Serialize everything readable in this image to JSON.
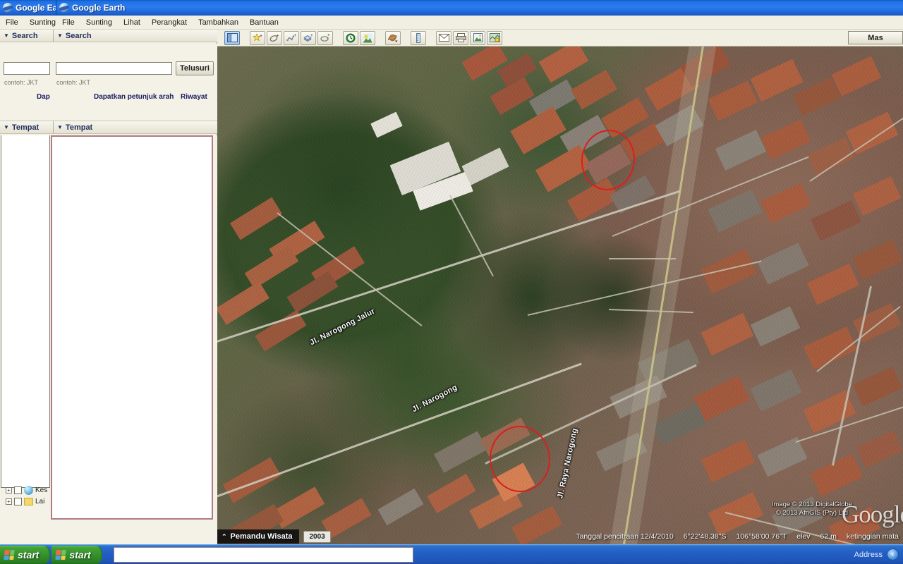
{
  "window": {
    "back_title": "Google Ea",
    "front_title": "Google Earth",
    "app_icon": "google-earth-globe-icon"
  },
  "menubar_back": [
    "File",
    "Sunting"
  ],
  "menubar_front": [
    "File",
    "Sunting",
    "Lihat",
    "Perangkat",
    "Tambahkan",
    "Bantuan"
  ],
  "sidebar": {
    "search_panel": {
      "title_back": "Search",
      "title_front": "Search",
      "input_small_value": "",
      "input_small_placeholder": "",
      "input_large_value": "",
      "input_large_placeholder": "",
      "search_button": "Telusuri",
      "hint_left": "contoh: JKT",
      "hint_right": "contoh: JKT",
      "link_directions_short": "Dap",
      "link_directions": "Dapatkan petunjuk arah",
      "link_history": "Riwayat"
    },
    "places_panel": {
      "title_back": "Tempat",
      "title_front": "Tempat"
    },
    "layers": [
      {
        "label": "Kes",
        "icon": "globe-icon",
        "checked": false
      },
      {
        "label": "Lai",
        "icon": "folder-icon",
        "checked": false
      }
    ]
  },
  "toolbar": {
    "buttons": [
      {
        "name": "toggle-sidebar",
        "glyph": "▥",
        "active": true
      },
      {
        "name": "add-placemark",
        "glyph": "★",
        "active": false
      },
      {
        "name": "add-polygon",
        "glyph": "⬭",
        "active": false
      },
      {
        "name": "add-path",
        "glyph": "⌁",
        "active": false
      },
      {
        "name": "add-image-overlay",
        "glyph": "▤",
        "active": false
      },
      {
        "name": "record-tour",
        "glyph": "⟳",
        "active": false
      },
      {
        "name": "historical-imagery",
        "glyph": "◷",
        "active": false
      },
      {
        "name": "sunlight",
        "glyph": "☀",
        "active": false
      },
      {
        "name": "planets",
        "glyph": "♄",
        "active": false
      },
      {
        "name": "ruler",
        "glyph": "▯",
        "active": false
      },
      {
        "name": "email",
        "glyph": "✉",
        "active": false
      },
      {
        "name": "print",
        "glyph": "⎙",
        "active": false
      },
      {
        "name": "save-image",
        "glyph": "🖫",
        "active": false
      },
      {
        "name": "view-in-maps",
        "glyph": "▩",
        "active": false
      }
    ],
    "right_button_label": "Mas"
  },
  "map": {
    "street_labels": [
      {
        "text": "Jl. Narogong Jalur",
        "angle": -27
      },
      {
        "text": "Jl. Narogong",
        "angle": -28
      },
      {
        "text": "Jl. Raya Narogong",
        "angle": -78
      }
    ],
    "copyright_line1": "Image © 2013 DigitalGlobe",
    "copyright_line2": "© 2013 AfriGIS (Pty) Ltd",
    "watermark": "Google",
    "annotations": [
      {
        "name": "red-circle-upper",
        "shape": "ellipse"
      },
      {
        "name": "red-circle-lower",
        "shape": "ellipse"
      }
    ]
  },
  "statusbar": {
    "tour_guide": "Pemandu Wisata",
    "history_year": "2003",
    "imagery_date": "Tanggal pencitraan 12/4/2010",
    "latitude": "6°22'48.38\"S",
    "longitude": "106°58'00.76\"T",
    "elev_label": "elev",
    "elev_value": "62 m",
    "eye_alt_label": "ketinggian mata"
  },
  "taskbar": {
    "start_label_1": "start",
    "start_label_2": "start",
    "input_value": "",
    "address_label": "Address",
    "tray_icon": "chevron-left-icon"
  },
  "colors": {
    "titlebar_blue": "#2b7cf0",
    "taskbar_blue": "#245fc4",
    "start_green": "#35912b",
    "annotation_red": "#e01b18",
    "panel_beige": "#f4f2e7",
    "header_text": "#22305c"
  }
}
